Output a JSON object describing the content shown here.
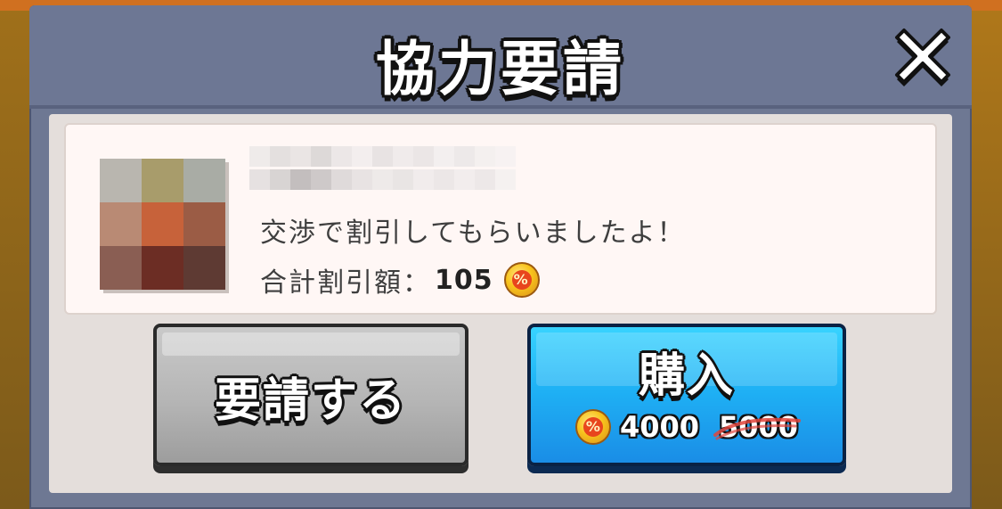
{
  "dialog": {
    "title": "協力要請",
    "close_icon": "close-x-icon"
  },
  "info": {
    "message": "交渉で割引してもらいましたよ！",
    "total_discount_label": "合計割引額：",
    "total_discount_value": "105",
    "coin_icon": "discount-coin-icon"
  },
  "buttons": {
    "request_label": "要請する",
    "buy_label": "購入",
    "price_new": "4000",
    "price_old": "5000"
  },
  "colors": {
    "header": "#6d7794",
    "buy_button": "#1fb2f5",
    "request_button": "#b5b5b5",
    "strike": "#e0453c"
  }
}
